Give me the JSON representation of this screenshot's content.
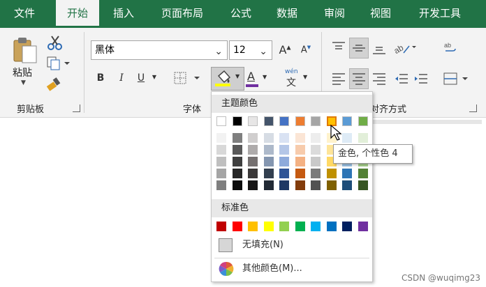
{
  "tabs": [
    "文件",
    "开始",
    "插入",
    "页面布局",
    "公式",
    "数据",
    "审阅",
    "视图",
    "开发工具"
  ],
  "active_tab_index": 1,
  "clipboard": {
    "paste_label": "粘贴",
    "group_label": "剪贴板"
  },
  "font": {
    "name": "黑体",
    "size": "12",
    "group_label": "字体",
    "bold": "B",
    "italic": "I",
    "underline": "U",
    "grow": "A",
    "shrink": "A",
    "phonetic_top": "wén",
    "phonetic_bottom": "文",
    "font_color_glyph": "A"
  },
  "alignment": {
    "group_label": "对齐方式"
  },
  "palette": {
    "theme_header": "主题颜色",
    "standard_header": "标准色",
    "no_fill": "无填充(N)",
    "more_colors": "其他颜色(M)...",
    "tooltip": "金色, 个性色 4",
    "theme_colors": [
      "#FFFFFF",
      "#000000",
      "#E7E6E6",
      "#44546A",
      "#4472C4",
      "#ED7D31",
      "#A5A5A5",
      "#FFC000",
      "#5B9BD5",
      "#70AD47"
    ],
    "shades": [
      [
        "#F2F2F2",
        "#7F7F7F",
        "#D0CECE",
        "#D6DCE4",
        "#D9E2F3",
        "#FBE5D5",
        "#EDEDED",
        "#FFF2CC",
        "#DEEBF6",
        "#E2EFD9"
      ],
      [
        "#D8D8D8",
        "#595959",
        "#AEABAB",
        "#ADB9CA",
        "#B4C6E7",
        "#F7CBAC",
        "#DBDBDB",
        "#FEE599",
        "#BDD7EE",
        "#C5E0B3"
      ],
      [
        "#BFBFBF",
        "#3F3F3F",
        "#757070",
        "#8496B0",
        "#8EAADB",
        "#F4B183",
        "#C9C9C9",
        "#FFD965",
        "#9CC3E5",
        "#A8D08D"
      ],
      [
        "#A5A5A5",
        "#262626",
        "#3A3838",
        "#323F4F",
        "#2F5496",
        "#C55A11",
        "#7B7B7B",
        "#BF9000",
        "#2E75B5",
        "#538135"
      ],
      [
        "#7F7F7F",
        "#0C0C0C",
        "#171616",
        "#222A35",
        "#1F3864",
        "#833C0B",
        "#525252",
        "#7F6000",
        "#1E4E79",
        "#375623"
      ]
    ],
    "standard_colors": [
      "#C00000",
      "#FF0000",
      "#FFC000",
      "#FFFF00",
      "#92D050",
      "#00B050",
      "#00B0F0",
      "#0070C0",
      "#002060",
      "#7030A0"
    ]
  },
  "watermark": "CSDN @wuqimg23",
  "colors": {
    "brand": "#217346",
    "fill_bar": "#FFFF00",
    "font_bar": "#7030A0"
  }
}
